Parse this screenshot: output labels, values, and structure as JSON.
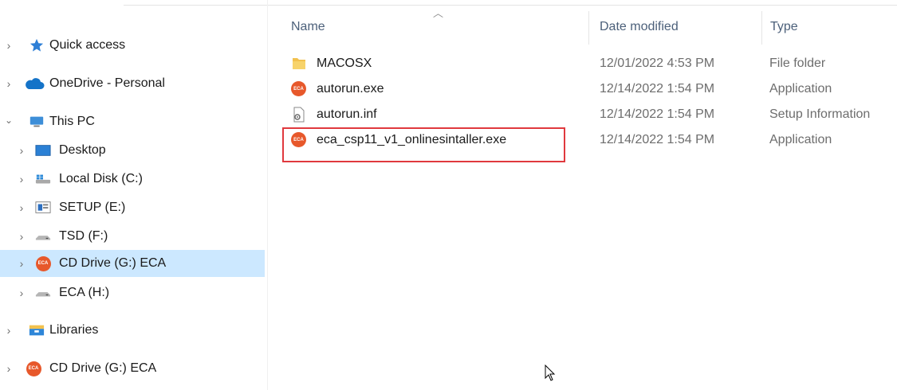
{
  "nav": {
    "items": [
      {
        "label": "Quick access",
        "expander": "›",
        "icon": "star-icon"
      },
      {
        "label": "OneDrive - Personal",
        "expander": "›",
        "icon": "cloud-icon"
      },
      {
        "label": "This PC",
        "expander": "⌄",
        "icon": "computer-icon"
      },
      {
        "label": "Desktop",
        "expander": "›",
        "icon": "desktop-icon"
      },
      {
        "label": "Local Disk (C:)",
        "expander": "›",
        "icon": "drive-icon"
      },
      {
        "label": "SETUP (E:)",
        "expander": "›",
        "icon": "setup-drive-icon"
      },
      {
        "label": "TSD (F:)",
        "expander": "›",
        "icon": "drive-icon"
      },
      {
        "label": "CD Drive (G:) ECA",
        "expander": "›",
        "icon": "eca-icon",
        "selected": true
      },
      {
        "label": "ECA (H:)",
        "expander": "›",
        "icon": "drive-icon"
      },
      {
        "label": "Libraries",
        "expander": "›",
        "icon": "libraries-icon"
      },
      {
        "label": "CD Drive (G:) ECA",
        "expander": "›",
        "icon": "eca-icon"
      }
    ]
  },
  "columns": {
    "name": "Name",
    "date": "Date modified",
    "type": "Type"
  },
  "files": [
    {
      "name": "MACOSX",
      "date": "12/01/2022 4:53 PM",
      "type": "File folder",
      "icon": "folder-icon"
    },
    {
      "name": "autorun.exe",
      "date": "12/14/2022 1:54 PM",
      "type": "Application",
      "icon": "eca-icon"
    },
    {
      "name": "autorun.inf",
      "date": "12/14/2022 1:54 PM",
      "type": "Setup Information",
      "icon": "settings-file-icon"
    },
    {
      "name": "eca_csp11_v1_onlinesintaller.exe",
      "date": "12/14/2022 1:54 PM",
      "type": "Application",
      "icon": "eca-icon",
      "highlighted": true
    }
  ],
  "badge_text": "ECA",
  "colors": {
    "selection": "#cce8ff",
    "highlight_border": "#e0393e",
    "eca_orange": "#e7582b",
    "folder": "#f2c14e"
  }
}
